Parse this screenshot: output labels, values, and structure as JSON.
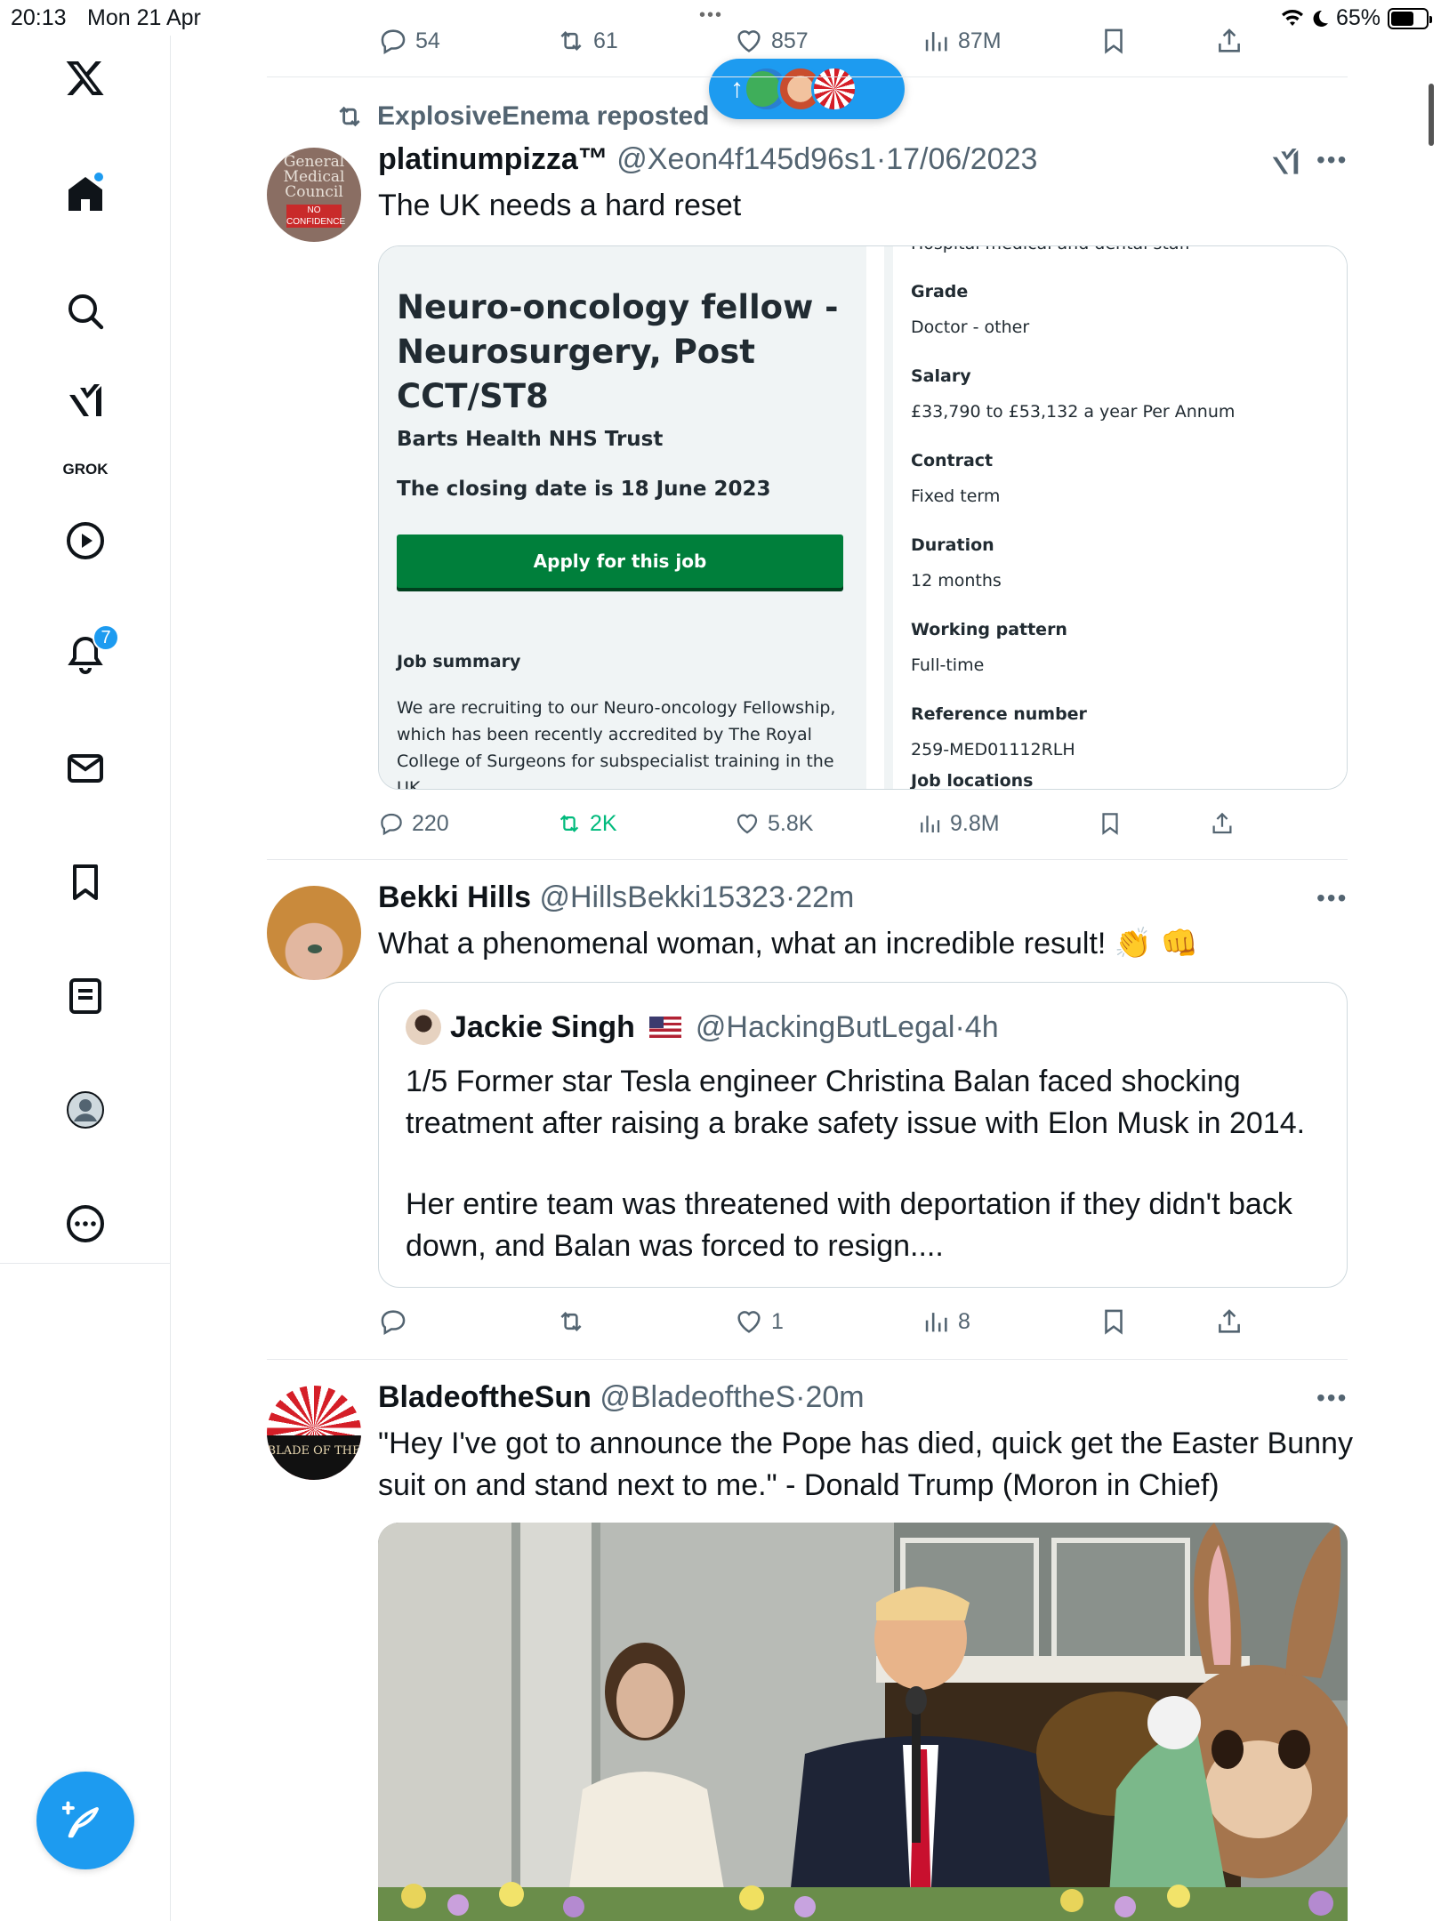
{
  "status_bar": {
    "time": "20:13",
    "date": "Mon 21 Apr",
    "battery": "65%",
    "battery_level": 0.65
  },
  "sidebar": {
    "grok_label": "GROK",
    "notifications_count": "7"
  },
  "top_actions": {
    "replies": "54",
    "reposts": "61",
    "likes": "857",
    "views": "87M"
  },
  "tweet1": {
    "repost_by": "ExplosiveEnema reposted",
    "name": "platinumpizza™",
    "handle": "@Xeon4f145d96s1",
    "date": "17/06/2023",
    "text": "The UK needs a hard reset",
    "avatar_text": [
      "General",
      "Medical",
      "Council",
      "NO",
      "CONFIDENCE"
    ],
    "card": {
      "title": "Neuro-oncology fellow - Neurosurgery, Post CCT/ST8",
      "trust": "Barts Health NHS Trust",
      "closing": "The closing date is 18 June 2023",
      "apply": "Apply for this job",
      "summary_heading": "Job summary",
      "summary": "We are recruiting to our Neuro-oncology Fellowship, which has been recently accredited by The Royal College of Surgeons for subspecialist training in the UK",
      "cut_top": "Hospital medical and dental staff",
      "grade_k": "Grade",
      "grade_v": "Doctor - other",
      "salary_k": "Salary",
      "salary_v": "£33,790 to £53,132 a year Per Annum",
      "contract_k": "Contract",
      "contract_v": "Fixed term",
      "duration_k": "Duration",
      "duration_v": "12 months",
      "pattern_k": "Working pattern",
      "pattern_v": "Full-time",
      "ref_k": "Reference number",
      "ref_v": "259-MED01112RLH",
      "loc_k": "Job locations"
    },
    "actions": {
      "replies": "220",
      "reposts": "2K",
      "likes": "5.8K",
      "views": "9.8M"
    }
  },
  "tweet2": {
    "name": "Bekki Hills",
    "handle": "@HillsBekki15323",
    "time": "22m",
    "text": "What a phenomenal woman, what an incredible result! 👏 👊",
    "quote": {
      "name": "Jackie Singh",
      "handle": "@HackingButLegal",
      "time": "4h",
      "text1": "1/5 Former star Tesla engineer Christina Balan faced shocking treatment after raising a brake safety issue with Elon Musk in 2014.",
      "text2": "Her entire team was threatened with deportation if they didn't back down, and Balan was forced to resign...."
    },
    "actions": {
      "replies": "",
      "reposts": "",
      "likes": "1",
      "views": "8"
    }
  },
  "tweet3": {
    "name": "BladeoftheSun",
    "handle": "@BladeoftheS",
    "time": "20m",
    "text": "\"Hey I've got to announce the Pope has died, quick get the Easter Bunny suit on and stand next to me.\" - Donald Trump (Moron in Chief)",
    "avatar_text": "BLADE OF THE"
  },
  "colors": {
    "accent": "#1d9bf0",
    "repost_green": "#00ba7c",
    "nhs_green": "#007f3b",
    "muted": "#536471"
  }
}
